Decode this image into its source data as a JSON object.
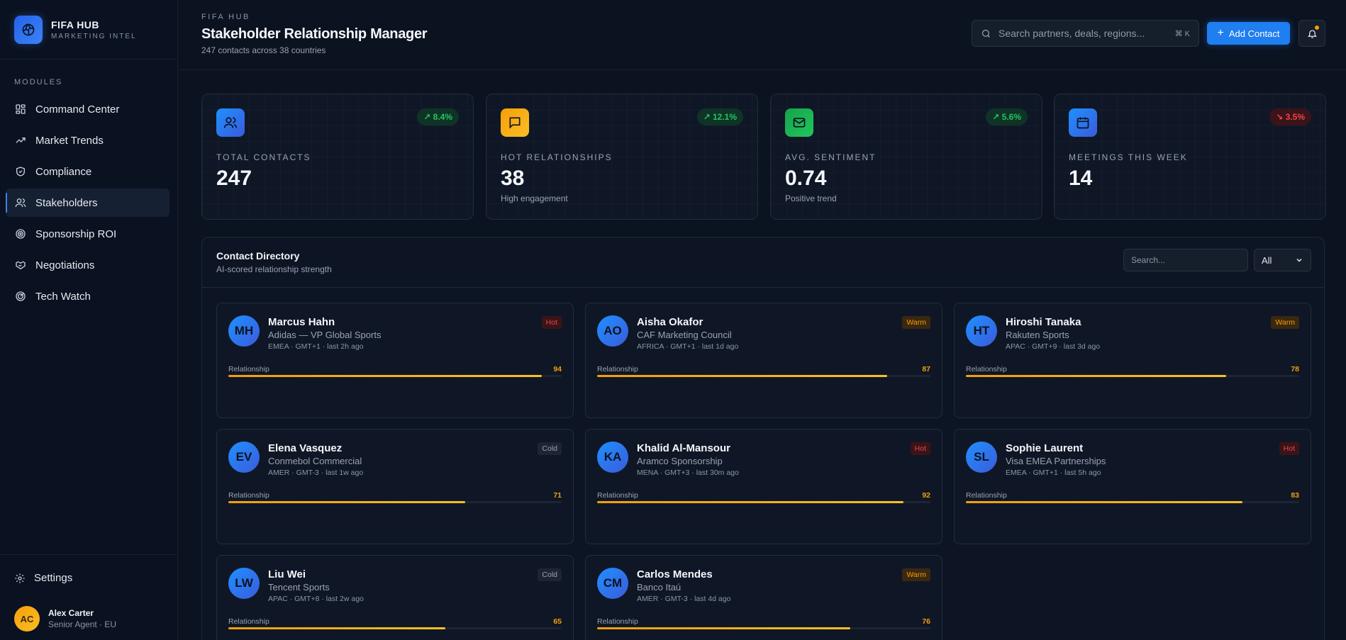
{
  "brand": {
    "name": "FIFA HUB",
    "subtitle": "MARKETING INTEL"
  },
  "sidebar": {
    "section_label": "MODULES",
    "items": [
      {
        "label": "Command Center",
        "icon": "grid-icon",
        "active": false
      },
      {
        "label": "Market Trends",
        "icon": "trend-icon",
        "active": false
      },
      {
        "label": "Compliance",
        "icon": "shield-icon",
        "active": false
      },
      {
        "label": "Stakeholders",
        "icon": "users-icon",
        "active": true
      },
      {
        "label": "Sponsorship ROI",
        "icon": "target-icon",
        "active": false
      },
      {
        "label": "Negotiations",
        "icon": "handshake-icon",
        "active": false
      },
      {
        "label": "Tech Watch",
        "icon": "radar-icon",
        "active": false
      }
    ],
    "settings_label": "Settings",
    "user": {
      "initials": "AC",
      "name": "Alex Carter",
      "role": "Senior Agent · EU"
    }
  },
  "header": {
    "kicker": "FIFA HUB",
    "title": "Stakeholder Relationship Manager",
    "subtitle": "247 contacts across 38 countries",
    "search_placeholder": "Search partners, deals, regions...",
    "search_shortcut": "⌘ K",
    "add_button": "Add Contact"
  },
  "stats": [
    {
      "label": "TOTAL CONTACTS",
      "value": "247",
      "note": "",
      "delta": "8.4%",
      "trend": "up",
      "icon": "users-icon",
      "color": "#3b82f6"
    },
    {
      "label": "HOT RELATIONSHIPS",
      "value": "38",
      "note": "High engagement",
      "delta": "12.1%",
      "trend": "up",
      "icon": "chat-icon",
      "color": "#f59e0b"
    },
    {
      "label": "AVG. SENTIMENT",
      "value": "0.74",
      "note": "Positive trend",
      "delta": "5.6%",
      "trend": "up",
      "icon": "mail-icon",
      "color": "#22c55e"
    },
    {
      "label": "MEETINGS THIS WEEK",
      "value": "14",
      "note": "",
      "delta": "3.5%",
      "trend": "down",
      "icon": "calendar-icon",
      "color": "#3b82f6"
    }
  ],
  "directory": {
    "title": "Contact Directory",
    "subtitle": "AI-scored relationship strength",
    "search_placeholder": "Search...",
    "filter_value": "All",
    "relationship_label": "Relationship",
    "contacts": [
      {
        "initials": "MH",
        "name": "Marcus Hahn",
        "org": "Adidas — VP Global Sports",
        "meta": "EMEA · GMT+1 · last 2h ago",
        "status": "Hot",
        "score": 94
      },
      {
        "initials": "AO",
        "name": "Aisha Okafor",
        "org": "CAF Marketing Council",
        "meta": "AFRICA · GMT+1 · last 1d ago",
        "status": "Warm",
        "score": 87
      },
      {
        "initials": "HT",
        "name": "Hiroshi Tanaka",
        "org": "Rakuten Sports",
        "meta": "APAC · GMT+9 · last 3d ago",
        "status": "Warm",
        "score": 78
      },
      {
        "initials": "EV",
        "name": "Elena Vasquez",
        "org": "Conmebol Commercial",
        "meta": "AMER · GMT-3 · last 1w ago",
        "status": "Cold",
        "score": 71
      },
      {
        "initials": "KA",
        "name": "Khalid Al-Mansour",
        "org": "Aramco Sponsorship",
        "meta": "MENA · GMT+3 · last 30m ago",
        "status": "Hot",
        "score": 92
      },
      {
        "initials": "SL",
        "name": "Sophie Laurent",
        "org": "Visa EMEA Partnerships",
        "meta": "EMEA · GMT+1 · last 5h ago",
        "status": "Hot",
        "score": 83
      },
      {
        "initials": "LW",
        "name": "Liu Wei",
        "org": "Tencent Sports",
        "meta": "APAC · GMT+8 · last 2w ago",
        "status": "Cold",
        "score": 65
      },
      {
        "initials": "CM",
        "name": "Carlos Mendes",
        "org": "Banco Itaú",
        "meta": "AMER · GMT-3 · last 4d ago",
        "status": "Warm",
        "score": 76
      }
    ]
  }
}
